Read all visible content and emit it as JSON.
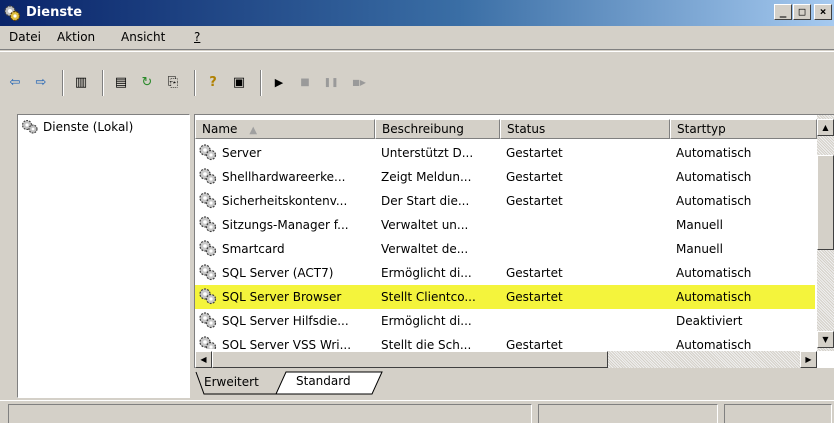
{
  "window": {
    "title": "Dienste",
    "minimize_label": "_",
    "maximize_label": "□",
    "close_label": "×"
  },
  "menu": {
    "items": [
      {
        "label": "Datei"
      },
      {
        "label": "Aktion"
      },
      {
        "label": "Ansicht"
      },
      {
        "label": "?"
      }
    ]
  },
  "toolbar": {
    "buttons": [
      {
        "icon": "back-arrow-icon",
        "glyph": "⇦"
      },
      {
        "icon": "forward-arrow-icon",
        "glyph": "⇨"
      },
      {
        "icon": "show-hide-tree-icon",
        "glyph": "▥"
      },
      {
        "icon": "properties-icon",
        "glyph": "▤"
      },
      {
        "icon": "refresh-icon",
        "glyph": "↻"
      },
      {
        "icon": "export-list-icon",
        "glyph": "⎘"
      },
      {
        "icon": "help-icon",
        "glyph": "?"
      },
      {
        "icon": "console-view-icon",
        "glyph": "▣"
      },
      {
        "icon": "start-service-icon",
        "glyph": "▶"
      },
      {
        "icon": "stop-service-icon",
        "glyph": "■"
      },
      {
        "icon": "pause-service-icon",
        "glyph": "❚❚"
      },
      {
        "icon": "restart-service-icon",
        "glyph": "■▶"
      }
    ]
  },
  "tree": {
    "root_label": "Dienste (Lokal)"
  },
  "list": {
    "columns": [
      "Name",
      "Beschreibung",
      "Status",
      "Starttyp"
    ],
    "sort_indicator": "▲",
    "rows": [
      {
        "name": "Server",
        "description": "Unterstützt D...",
        "status": "Gestartet",
        "starttype": "Automatisch",
        "selected": false
      },
      {
        "name": "Shellhardwareerke...",
        "description": "Zeigt Meldun...",
        "status": "Gestartet",
        "starttype": "Automatisch",
        "selected": false
      },
      {
        "name": "Sicherheitskontenv...",
        "description": "Der Start die...",
        "status": "Gestartet",
        "starttype": "Automatisch",
        "selected": false
      },
      {
        "name": "Sitzungs-Manager f...",
        "description": "Verwaltet un...",
        "status": "",
        "starttype": "Manuell",
        "selected": false
      },
      {
        "name": "Smartcard",
        "description": "Verwaltet de...",
        "status": "",
        "starttype": "Manuell",
        "selected": false
      },
      {
        "name": "SQL Server (ACT7)",
        "description": "Ermöglicht di...",
        "status": "Gestartet",
        "starttype": "Automatisch",
        "selected": false
      },
      {
        "name": "SQL Server Browser",
        "description": "Stellt Clientco...",
        "status": "Gestartet",
        "starttype": "Automatisch",
        "selected": true
      },
      {
        "name": "SQL Server Hilfsdie...",
        "description": "Ermöglicht di...",
        "status": "",
        "starttype": "Deaktiviert",
        "selected": false
      },
      {
        "name": "SQL Server VSS Wri...",
        "description": "Stellt die Sch...",
        "status": "Gestartet",
        "starttype": "Automatisch",
        "selected": false
      }
    ]
  },
  "tabs": [
    {
      "label": "Erweitert",
      "active": false
    },
    {
      "label": "Standard",
      "active": true
    }
  ],
  "colors": {
    "selection_highlight": "#f4f43c",
    "title_gradient_start": "#0a246a",
    "title_gradient_end": "#a6caf0"
  }
}
